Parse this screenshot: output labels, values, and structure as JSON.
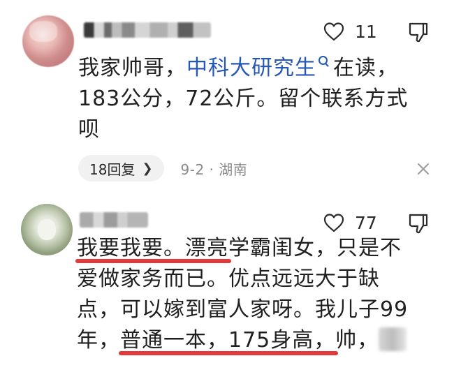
{
  "comments": [
    {
      "likes": "11",
      "text_pre": "我家帅哥，",
      "text_link": "中科大研究生",
      "text_post_line1": "在读，",
      "text_line2": "183公分，72公斤。留个联系方式",
      "text_line3": "呗",
      "reply_label": "18回复",
      "meta": "9-2 · 湖南"
    },
    {
      "likes": "77",
      "line1_underlined": "我要我要。漂亮",
      "line1_rest": "学霸闺女，只是不",
      "line2": "爱做家务而已。优点远远大于缺",
      "line3": "点，可以嫁到富人家呀。我儿子99",
      "line4_pre": "年，",
      "line4_underlined": "普通一本，175身高，",
      "line4_post": "帅，"
    }
  ],
  "colors": {
    "link": "#2457b6",
    "underline": "#e03a3a",
    "meta": "#8a8a8a"
  },
  "icons": [
    "heart-outline-icon",
    "thumbs-down-icon",
    "chevron-right-icon",
    "close-icon",
    "search-icon"
  ]
}
